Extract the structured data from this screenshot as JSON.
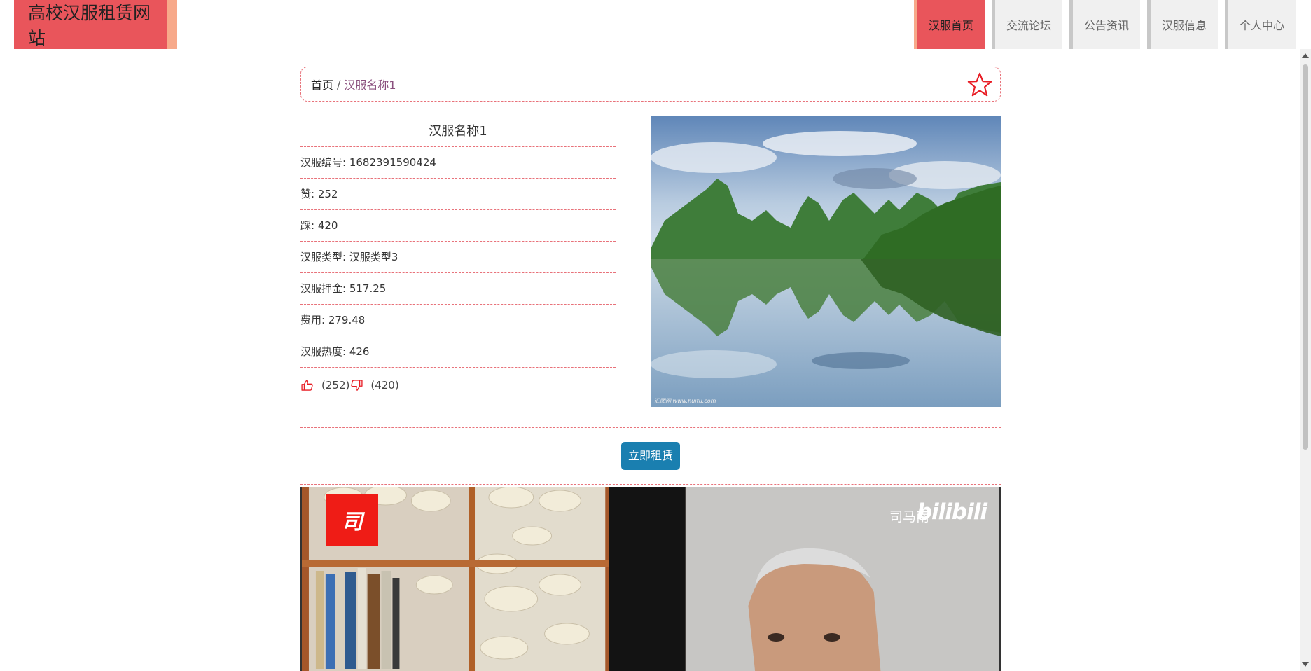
{
  "site": {
    "title": "高校汉服租赁网站"
  },
  "nav": {
    "items": [
      {
        "label": "汉服首页",
        "active": true
      },
      {
        "label": "交流论坛",
        "active": false
      },
      {
        "label": "公告资讯",
        "active": false
      },
      {
        "label": "汉服信息",
        "active": false
      },
      {
        "label": "个人中心",
        "active": false
      }
    ]
  },
  "breadcrumb": {
    "home": "首页",
    "separator": "/",
    "current": "汉服名称1"
  },
  "detail": {
    "name": "汉服名称1",
    "fields": [
      {
        "label": "汉服编号",
        "value": "1682391590424"
      },
      {
        "label": "赞",
        "value": "252"
      },
      {
        "label": "踩",
        "value": "420"
      },
      {
        "label": "汉服类型",
        "value": "汉服类型3"
      },
      {
        "label": "汉服押金",
        "value": "517.25"
      },
      {
        "label": "费用",
        "value": "279.48"
      },
      {
        "label": "汉服热度",
        "value": "426"
      }
    ],
    "thumbs_up_count": "(252)",
    "thumbs_down_count": "(420)",
    "photo_credit": "汇图网 www.huitu.com"
  },
  "actions": {
    "rent_label": "立即租赁"
  },
  "video": {
    "logo_char": "司",
    "channel_name": "司马南",
    "platform_mark": "bilibili"
  },
  "colors": {
    "accent": "#e9555b",
    "accent_edge": "#f7a98a",
    "button": "#1a7fb0",
    "dash": "#e8727a"
  },
  "icons": [
    "star-icon",
    "thumbs-up-icon",
    "thumbs-down-icon"
  ]
}
